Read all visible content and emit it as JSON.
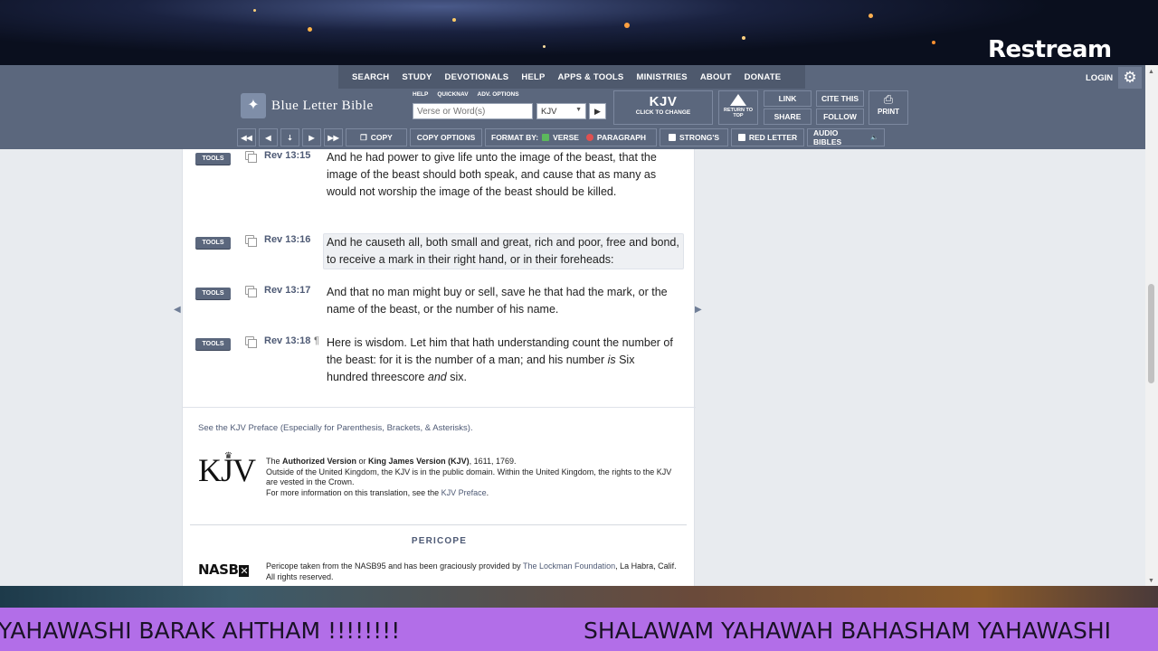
{
  "overlay": {
    "brand": "Restream"
  },
  "nav": {
    "items": [
      "SEARCH",
      "STUDY",
      "DEVOTIONALS",
      "HELP",
      "APPS & TOOLS",
      "MINISTRIES",
      "ABOUT",
      "DONATE"
    ],
    "login": "LOGIN"
  },
  "header": {
    "logo": "Blue Letter Bible",
    "mini_links": [
      "HELP",
      "QUICKNAV",
      "ADV. OPTIONS"
    ],
    "search_placeholder": "Verse or Word(s)",
    "version": "KJV",
    "version_box": {
      "title": "KJV",
      "subtitle": "CLICK TO CHANGE"
    },
    "return_top": "RETURN TO TOP",
    "link": "LINK",
    "share": "SHARE",
    "cite": "CITE THIS",
    "follow": "FOLLOW",
    "print": "PRINT"
  },
  "toolbar": {
    "copy": "COPY",
    "copy_options": "COPY OPTIONS",
    "format_by": "FORMAT BY:",
    "verse": "VERSE",
    "paragraph": "PARAGRAPH",
    "strongs": "STRONG'S",
    "red_letter": "RED LETTER",
    "audio": "AUDIO BIBLES"
  },
  "verses": [
    {
      "ref": "Rev 13:15",
      "text": "And he had power to give life unto the image of the beast, that the image of the beast should both speak, and cause that as many as would not worship the image of the beast should be killed."
    },
    {
      "ref": "Rev 13:16",
      "text": "And he causeth all, both small and great, rich and poor, free and bond, to receive a mark in their right hand, or in their foreheads:"
    },
    {
      "ref": "Rev 13:17",
      "text": "And that no man might buy or sell, save he that had the mark, or the name of the beast, or the number of his name."
    },
    {
      "ref": "Rev 13:18",
      "text_a": "Here is wisdom. Let him that hath understanding count the number of the beast: for it is the number of a man; and his number ",
      "text_is": "is",
      "text_b": " Six hundred threescore ",
      "text_and": "and",
      "text_c": " six."
    }
  ],
  "tools_label": "TOOLS",
  "footer": {
    "preface_link": "See the KJV Preface (Especially for Parenthesis, Brackets, & Asterisks).",
    "kjv_logo": "KJV",
    "kjv_line1_the": "The ",
    "kjv_line1_av": "Authorized Version",
    "kjv_line1_or": " or ",
    "kjv_line1_kjv": "King James Version (KJV)",
    "kjv_line1_years": ", 1611, 1769.",
    "kjv_line2": "Outside of the United Kingdom, the KJV is in the public domain. Within the United Kingdom, the rights to the KJV are vested in the Crown.",
    "kjv_line3": "For more information on this translation, see the ",
    "kjv_line3_link": "KJV Preface",
    "pericope": "PERICOPE",
    "nasb_logo": "NASB",
    "nasb_text": "Pericope taken from the NASB95 and has been graciously provided by ",
    "nasb_link": "The Lockman Foundation",
    "nasb_text2": ", La Habra, Calif. All rights reserved."
  },
  "ticker": {
    "left": "YAHAWASHI BARAK AHTHAM !!!!!!!!",
    "right": "SHALAWAM YAHAWAH BAHASHAM YAHAWASHI"
  }
}
